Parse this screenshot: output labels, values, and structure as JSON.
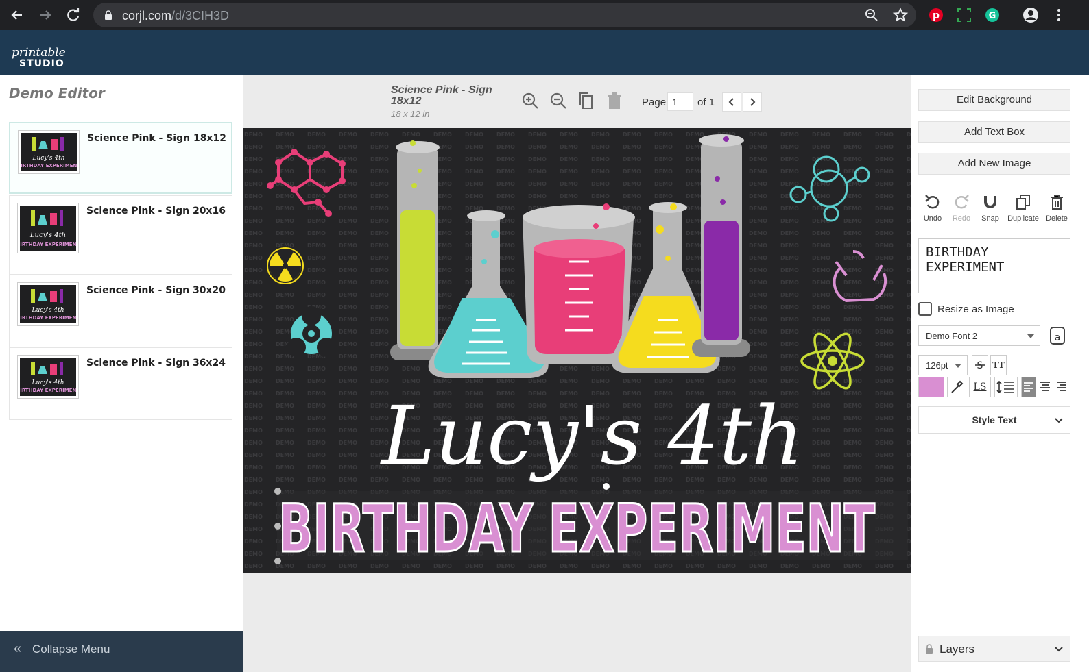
{
  "browser": {
    "url_host": "corjl.com",
    "url_path": "/d/3CIH3D"
  },
  "sidebar": {
    "title": "Demo Editor",
    "templates": [
      {
        "label": "Science Pink - Sign 18x12",
        "active": true
      },
      {
        "label": "Science Pink - Sign 20x16",
        "active": false
      },
      {
        "label": "Science Pink - Sign 30x20",
        "active": false
      },
      {
        "label": "Science Pink - Sign 36x24",
        "active": false
      }
    ],
    "collapse_label": "Collapse Menu"
  },
  "canvas": {
    "doc_name": "Science Pink - Sign 18x12",
    "doc_size": "18 x 12 in",
    "page_label": "Page",
    "page_value": "1",
    "page_of": "of 1",
    "design": {
      "headline": "Lucy's 4th",
      "subline": "BIRTHDAY EXPERIMENT",
      "watermark": "DEMO",
      "colors": {
        "background": "#242426",
        "pink": "#e83e78",
        "teal": "#5ccfce",
        "lime": "#c8dc35",
        "yellow": "#f5dc1e",
        "purple": "#8a2aa8",
        "lavender": "#d98fd2"
      }
    }
  },
  "panel": {
    "edit_background": "Edit Background",
    "add_text_box": "Add Text Box",
    "add_new_image": "Add New Image",
    "actions": [
      "Undo",
      "Redo",
      "Snap",
      "Duplicate",
      "Delete"
    ],
    "text_value": "BIRTHDAY EXPERIMENT",
    "resize_label": "Resize as Image",
    "font": "Demo Font 2",
    "font_size": "126pt",
    "ls_label": "LS",
    "tt_label": "TT",
    "text_color": "#d98fd2",
    "style_text": "Style Text",
    "layers": "Layers"
  }
}
